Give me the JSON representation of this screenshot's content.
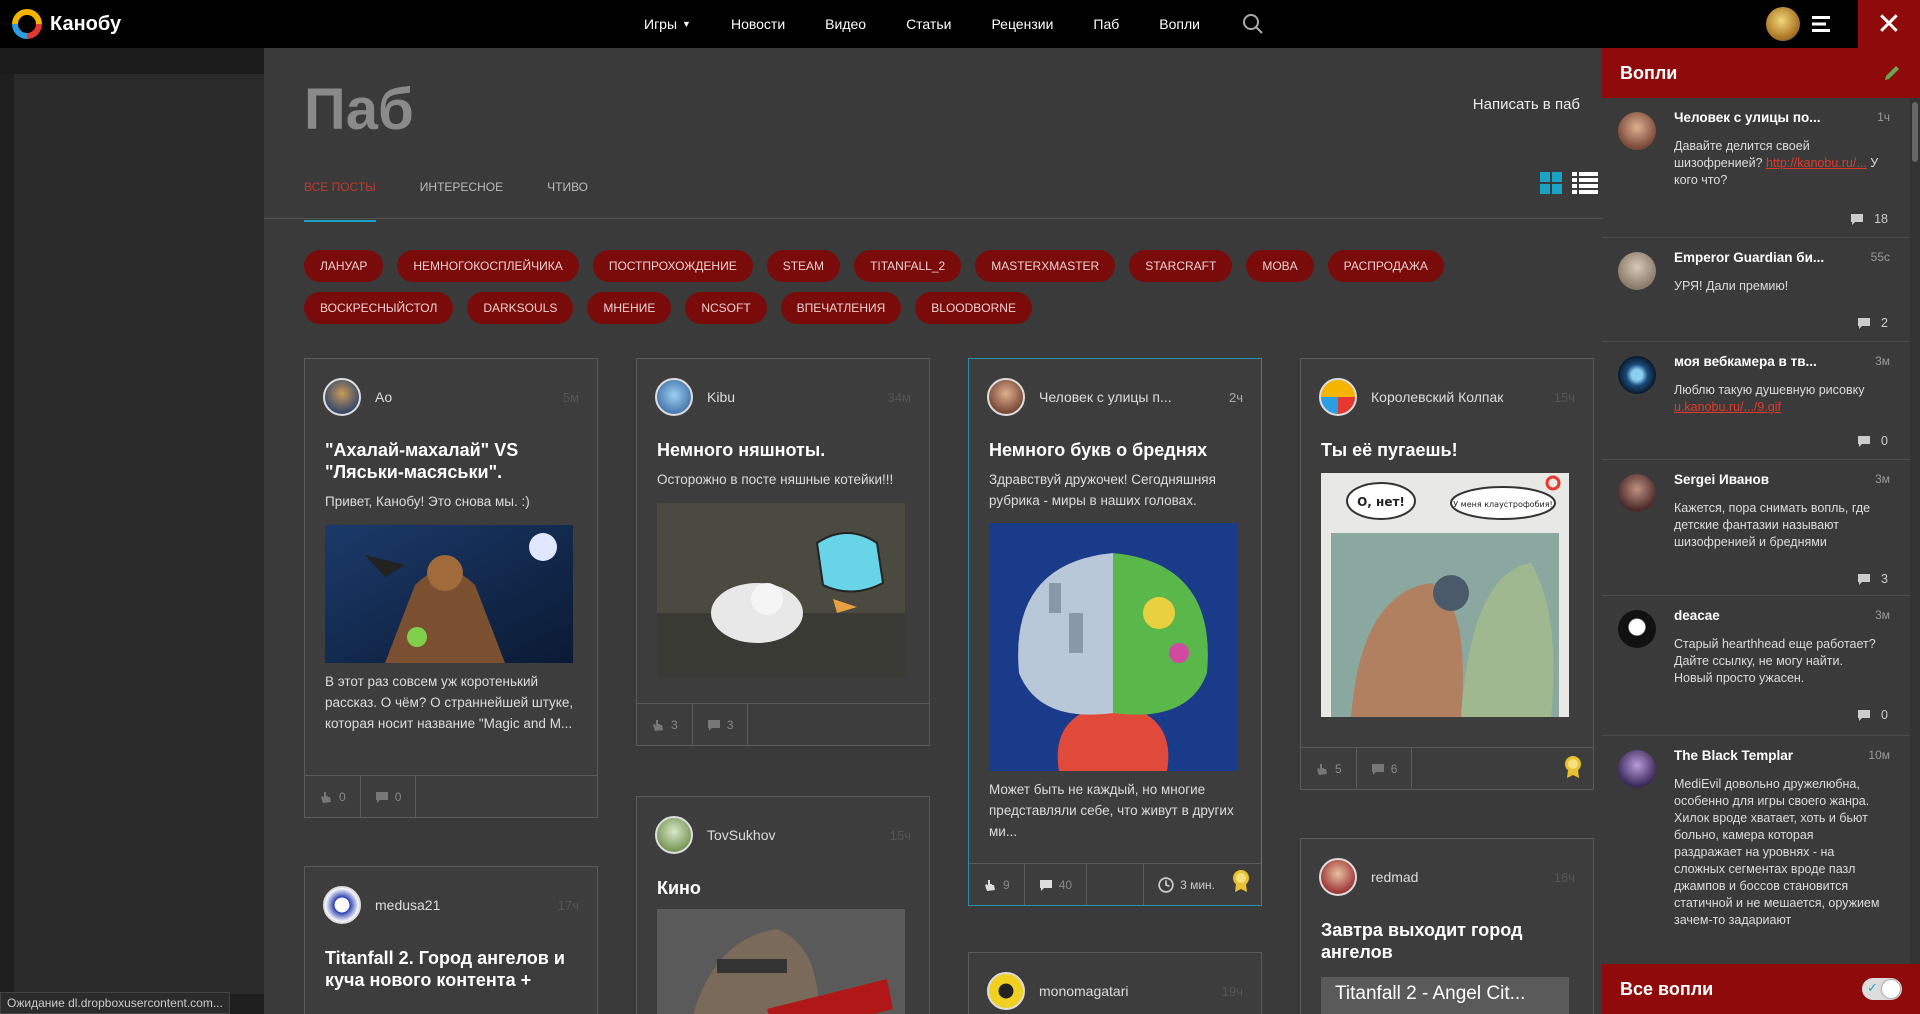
{
  "header": {
    "logo_text": "Канобу",
    "nav": [
      {
        "label": "Игры",
        "has_caret": true
      },
      {
        "label": "Новости"
      },
      {
        "label": "Видео"
      },
      {
        "label": "Статьи"
      },
      {
        "label": "Рецензии"
      },
      {
        "label": "Паб"
      },
      {
        "label": "Вопли"
      }
    ],
    "close_glyph": "✕"
  },
  "page": {
    "title": "Паб",
    "write_link": "Написать в паб",
    "tabs": [
      "Все посты",
      "Интересное",
      "Чтиво"
    ],
    "active_tab": 0
  },
  "tags": [
    "ЛАНУАР",
    "НЕМНОГОКОСПЛЕЙЧИКА",
    "ПОСТПРОХОЖДЕНИЕ",
    "STEAM",
    "TITANFALL_2",
    "MASTERXMASTER",
    "STARCRAFT",
    "MOBA",
    "РАСПРОДАЖА",
    "ВОСКРЕСНЫЙСТОЛ",
    "DARKSOULS",
    "МНЕНИЕ",
    "NCSOFT",
    "ВПЕЧАТЛЕНИЯ",
    "BLOODBORNE"
  ],
  "cards": [
    {
      "author": "Ao",
      "time": "5м",
      "title": "\"Ахалай-махалай\" VS \"Ляськи-масяськи\".",
      "intro": "Привет, Канобу! Это снова мы. :)",
      "text": "В этот раз совсем уж коротенький рассказ. О чём? О страннейшей штуке, которая носит название \"Magic and M...",
      "likes": "0",
      "comments": "0"
    },
    {
      "author": "Kibu",
      "time": "34м",
      "title": "Немного няшноты.",
      "intro": "Осторожно в посте няшные котейки!!!",
      "likes": "3",
      "comments": "3"
    },
    {
      "author": "Человек с улицы п...",
      "time": "2ч",
      "title": "Немного букв о бреднях",
      "intro": "Здравствуй дружочек! Сегодняшняя рубрика - миры в наших головах.",
      "text": "Может быть не каждый, но многие представляли себе, что живут в других ми...",
      "likes": "9",
      "comments": "40",
      "read_time": "3 мин."
    },
    {
      "author": "Королевский Колпак",
      "time": "15ч",
      "title": "Ты её пугаешь!",
      "likes": "5",
      "comments": "6",
      "img_bubble_1": "О, нет!",
      "img_bubble_2": "У меня клаустрофобия!"
    },
    {
      "author": "medusa21",
      "time": "17ч",
      "title": "Titanfall 2. Город ангелов и куча нового контента +"
    },
    {
      "author": "TovSukhov",
      "time": "15ч",
      "title": "Кино"
    },
    {
      "author": "redmad",
      "time": "16ч",
      "title": "Завтра выходит город ангелов",
      "video_title": "Titanfall 2 - Angel Cit..."
    },
    {
      "author": "monomagatari",
      "time": "19ч"
    }
  ],
  "sidebar": {
    "title": "Вопли",
    "items": [
      {
        "name": "Человек с улицы по...",
        "time": "1ч",
        "text_pre": "Давайте делится своей шизофренией? ",
        "link": "http://kanobu.ru/...",
        "text_post": " У кого что?",
        "comments": "18"
      },
      {
        "name": "Emperor Guardian би...",
        "time": "55с",
        "text_pre": "УРЯ! Дали премию!",
        "comments": "2"
      },
      {
        "name": "моя вебкамера в тв...",
        "time": "3м",
        "text_pre": "Люблю такую душевную рисовку ",
        "link": "u.kanobu.ru/.../9.gif",
        "comments": "0"
      },
      {
        "name": "Sergei Иванов",
        "time": "3м",
        "text_pre": "Кажется, пора снимать вопль, где детские фантазии называют шизофренией и бреднями",
        "comments": "3"
      },
      {
        "name": "deacae",
        "time": "3м",
        "text_pre": "Старый hearthhead еще работает? Дайте ссылку, не могу найти. Новый просто ужасен.",
        "comments": "0"
      },
      {
        "name": "The Black Templar",
        "time": "10м",
        "text_pre": "MediEvil довольно дружелюбна, особенно для игры своего жанра. Хилок вроде хватает, хоть и бьют больно, камера которая раздражает на уровнях - на сложных сегментах вроде пазл джампов и боссов становится статичной и не мешается, оружием зачем-то задариают"
      }
    ],
    "footer": "Все вопли"
  },
  "status": "Ожидание dl.dropboxusercontent.com..."
}
